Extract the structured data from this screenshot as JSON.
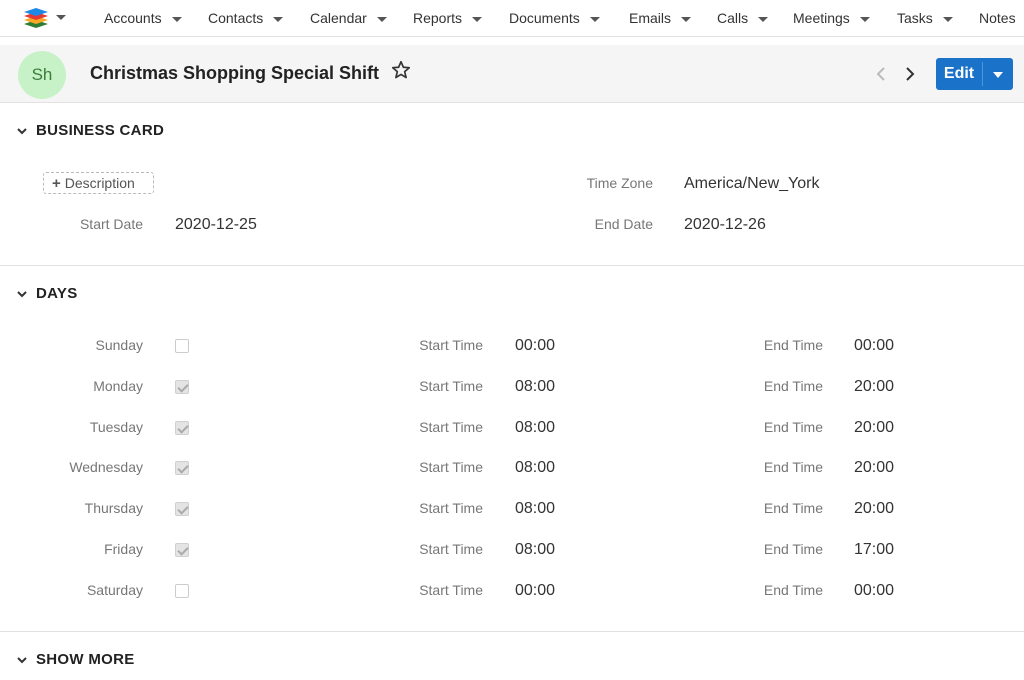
{
  "nav": {
    "items": [
      {
        "label": "Accounts"
      },
      {
        "label": "Contacts"
      },
      {
        "label": "Calendar"
      },
      {
        "label": "Reports"
      },
      {
        "label": "Documents"
      },
      {
        "label": "Emails"
      },
      {
        "label": "Calls"
      },
      {
        "label": "Meetings"
      },
      {
        "label": "Tasks"
      },
      {
        "label": "Notes"
      }
    ]
  },
  "header": {
    "avatar_initials": "Sh",
    "title": "Christmas Shopping Special Shift",
    "edit_label": "Edit",
    "accent_color": "#1a73c8"
  },
  "business_card": {
    "section_title": "BUSINESS CARD",
    "description_button": "Description",
    "time_zone_label": "Time Zone",
    "time_zone_value": "America/New_York",
    "start_date_label": "Start Date",
    "start_date_value": "2020-12-25",
    "end_date_label": "End Date",
    "end_date_value": "2020-12-26"
  },
  "days": {
    "section_title": "DAYS",
    "start_time_label": "Start Time",
    "end_time_label": "End Time",
    "rows": [
      {
        "day": "Sunday",
        "checked": false,
        "start": "00:00",
        "end": "00:00"
      },
      {
        "day": "Monday",
        "checked": true,
        "start": "08:00",
        "end": "20:00"
      },
      {
        "day": "Tuesday",
        "checked": true,
        "start": "08:00",
        "end": "20:00"
      },
      {
        "day": "Wednesday",
        "checked": true,
        "start": "08:00",
        "end": "20:00"
      },
      {
        "day": "Thursday",
        "checked": true,
        "start": "08:00",
        "end": "20:00"
      },
      {
        "day": "Friday",
        "checked": true,
        "start": "08:00",
        "end": "17:00"
      },
      {
        "day": "Saturday",
        "checked": false,
        "start": "00:00",
        "end": "00:00"
      }
    ]
  },
  "show_more": {
    "section_title": "SHOW MORE"
  }
}
